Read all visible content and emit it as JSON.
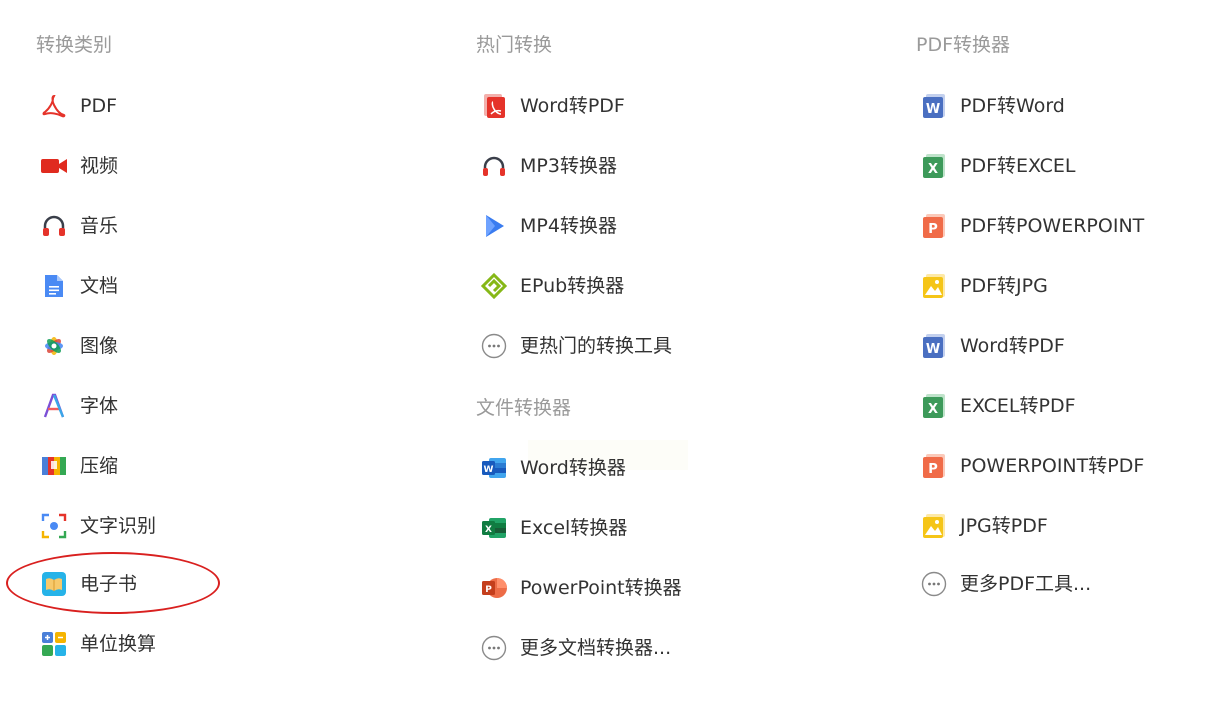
{
  "categories": {
    "title": "转换类别",
    "items": [
      {
        "label": "PDF"
      },
      {
        "label": "视频"
      },
      {
        "label": "音乐"
      },
      {
        "label": "文档"
      },
      {
        "label": "图像"
      },
      {
        "label": "字体"
      },
      {
        "label": "压缩"
      },
      {
        "label": "文字识别"
      },
      {
        "label": "电子书"
      },
      {
        "label": "单位换算"
      }
    ]
  },
  "popular": {
    "title": "热门转换",
    "items": [
      {
        "label": "Word转PDF"
      },
      {
        "label": "MP3转换器"
      },
      {
        "label": "MP4转换器"
      },
      {
        "label": "EPub转换器"
      },
      {
        "label": "更热门的转换工具"
      }
    ]
  },
  "file_converters": {
    "title": "文件转换器",
    "items": [
      {
        "label": "Word转换器"
      },
      {
        "label": "Excel转换器"
      },
      {
        "label": "PowerPoint转换器"
      },
      {
        "label": "更多文档转换器..."
      }
    ]
  },
  "pdf_converters": {
    "title": "PDF转换器",
    "items": [
      {
        "label": "PDF转Word"
      },
      {
        "label": "PDF转EXCEL"
      },
      {
        "label": "PDF转POWERPOINT"
      },
      {
        "label": "PDF转JPG"
      },
      {
        "label": "Word转PDF"
      },
      {
        "label": "EXCEL转PDF"
      },
      {
        "label": "POWERPOINT转PDF"
      },
      {
        "label": "JPG转PDF"
      },
      {
        "label": "更多PDF工具..."
      }
    ]
  },
  "colors": {
    "highlight_circle": "#d9201f",
    "pdf_red": "#e5332a",
    "word_blue": "#4a6fc1",
    "excel_green": "#3d9a5a",
    "powerpoint_orange": "#f06b48",
    "jpg_yellow": "#f5c518"
  }
}
